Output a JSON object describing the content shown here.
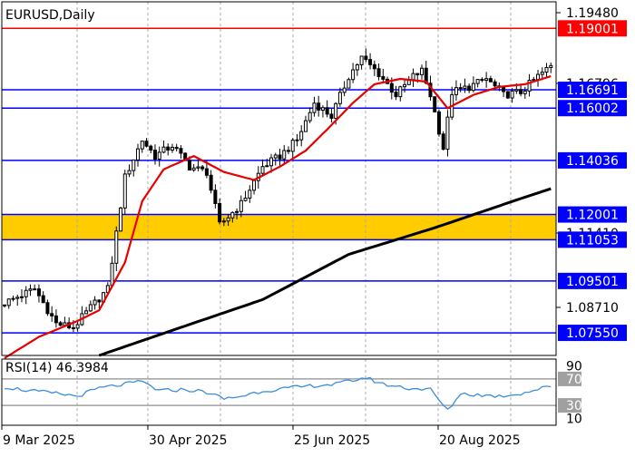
{
  "chart_data": {
    "type": "candlestick",
    "title": "EURUSD,Daily",
    "price_axis_ticks": [
      "1.19480",
      "1.16796",
      "1.11410",
      "1.08710"
    ],
    "date_labels": [
      "9 Mar 2025",
      "30 Apr 2025",
      "25 Jun 2025",
      "20 Aug 2025"
    ],
    "ylim": [
      1.067,
      1.2
    ],
    "candle_count": 128,
    "levels": [
      {
        "value": 1.19001,
        "label": "1.19001",
        "color": "#ff0000"
      },
      {
        "value": 1.16691,
        "label": "1.16691",
        "color": "#0000ff"
      },
      {
        "value": 1.16002,
        "label": "1.16002",
        "color": "#0000ff"
      },
      {
        "value": 1.14036,
        "label": "1.14036",
        "color": "#0000ff"
      },
      {
        "value": 1.12001,
        "label": "1.12001",
        "color": "#0000ff"
      },
      {
        "value": 1.11053,
        "label": "1.11053",
        "color": "#0000ff"
      },
      {
        "value": 1.09501,
        "label": "1.09501",
        "color": "#0000ff"
      },
      {
        "value": 1.0755,
        "label": "1.07550",
        "color": "#0000ff"
      }
    ],
    "zone": {
      "from": 1.11053,
      "to": 1.12001,
      "color": "#ffcc00"
    },
    "close_anchors": [
      [
        0,
        1.086
      ],
      [
        4,
        1.089
      ],
      [
        8,
        1.092
      ],
      [
        13,
        1.079
      ],
      [
        17,
        1.0775
      ],
      [
        21,
        1.085
      ],
      [
        25,
        1.092
      ],
      [
        29,
        1.134
      ],
      [
        33,
        1.148
      ],
      [
        36,
        1.142
      ],
      [
        40,
        1.146
      ],
      [
        44,
        1.138
      ],
      [
        48,
        1.136
      ],
      [
        51,
        1.116
      ],
      [
        56,
        1.124
      ],
      [
        61,
        1.138
      ],
      [
        65,
        1.142
      ],
      [
        69,
        1.148
      ],
      [
        73,
        1.162
      ],
      [
        77,
        1.157
      ],
      [
        81,
        1.172
      ],
      [
        84,
        1.179
      ],
      [
        88,
        1.173
      ],
      [
        92,
        1.165
      ],
      [
        96,
        1.172
      ],
      [
        98,
        1.174
      ],
      [
        100,
        1.165
      ],
      [
        103,
        1.145
      ],
      [
        105,
        1.166
      ],
      [
        109,
        1.168
      ],
      [
        113,
        1.171
      ],
      [
        117,
        1.165
      ],
      [
        121,
        1.166
      ],
      [
        125,
        1.172
      ],
      [
        129,
        1.177
      ],
      [
        131,
        1.188
      ],
      [
        134,
        1.173
      ],
      [
        137,
        1.17
      ]
    ],
    "ma_fast_anchors": [
      [
        0,
        1.066
      ],
      [
        8,
        1.074
      ],
      [
        17,
        1.08
      ],
      [
        22,
        1.084
      ],
      [
        28,
        1.102
      ],
      [
        32,
        1.125
      ],
      [
        37,
        1.137
      ],
      [
        44,
        1.142
      ],
      [
        51,
        1.136
      ],
      [
        58,
        1.133
      ],
      [
        64,
        1.138
      ],
      [
        70,
        1.144
      ],
      [
        75,
        1.152
      ],
      [
        81,
        1.162
      ],
      [
        86,
        1.169
      ],
      [
        92,
        1.171
      ],
      [
        98,
        1.17
      ],
      [
        103,
        1.16
      ],
      [
        109,
        1.165
      ],
      [
        115,
        1.168
      ],
      [
        121,
        1.169
      ],
      [
        127,
        1.172
      ],
      [
        133,
        1.175
      ],
      [
        137,
        1.172
      ]
    ],
    "ma_slow_anchors": [
      [
        22,
        1.067
      ],
      [
        40,
        1.077
      ],
      [
        60,
        1.088
      ],
      [
        80,
        1.105
      ],
      [
        100,
        1.115
      ],
      [
        120,
        1.126
      ],
      [
        137,
        1.135
      ]
    ],
    "rsi": {
      "label": "RSI(14) 46.3984",
      "period": 14,
      "last_value": 46.3984,
      "levels": [
        70,
        30
      ],
      "axis_ticks": [
        "90",
        "70",
        "30",
        "10"
      ],
      "ylim": [
        0,
        100
      ],
      "anchors": [
        [
          0,
          58
        ],
        [
          6,
          52
        ],
        [
          12,
          48
        ],
        [
          17,
          44
        ],
        [
          22,
          56
        ],
        [
          28,
          62
        ],
        [
          32,
          66
        ],
        [
          36,
          52
        ],
        [
          42,
          54
        ],
        [
          47,
          50
        ],
        [
          51,
          40
        ],
        [
          55,
          44
        ],
        [
          60,
          52
        ],
        [
          66,
          56
        ],
        [
          72,
          60
        ],
        [
          77,
          62
        ],
        [
          81,
          68
        ],
        [
          84,
          72
        ],
        [
          88,
          62
        ],
        [
          94,
          56
        ],
        [
          99,
          54
        ],
        [
          103,
          22
        ],
        [
          106,
          48
        ],
        [
          110,
          46
        ],
        [
          115,
          44
        ],
        [
          120,
          48
        ],
        [
          125,
          56
        ],
        [
          129,
          62
        ],
        [
          132,
          64
        ],
        [
          135,
          52
        ],
        [
          137,
          46
        ]
      ]
    }
  }
}
